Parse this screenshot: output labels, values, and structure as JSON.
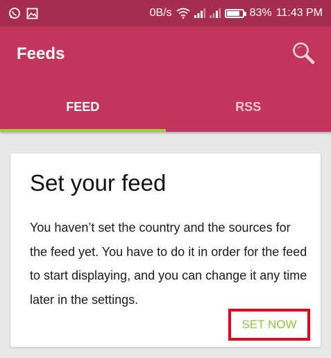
{
  "status_bar": {
    "network_speed": "0B/s",
    "battery": "83%",
    "battery_level": 0.83,
    "time": "11:43 PM",
    "icons": [
      "whatsapp-icon",
      "image-icon",
      "wifi-icon",
      "signal-icon",
      "signal-icon-2",
      "battery-icon"
    ]
  },
  "app_bar": {
    "title": "Feeds",
    "search_icon": "search-icon"
  },
  "tabs": [
    {
      "label": "FEED",
      "active": true
    },
    {
      "label": "RSS",
      "active": false
    }
  ],
  "card": {
    "title": "Set your feed",
    "body": "You haven’t set the country and the sources for the feed yet. You have to do it in order for the feed to start displaying, and you can change it any time later in the settings.",
    "action_label": "SET NOW"
  },
  "colors": {
    "status_bar": "#a62d50",
    "app_bar": "#c2365e",
    "tab_indicator": "#9ccc3c",
    "action_text": "#8dc63f",
    "highlight_border": "#e8001c",
    "background": "#e8e8e8"
  }
}
